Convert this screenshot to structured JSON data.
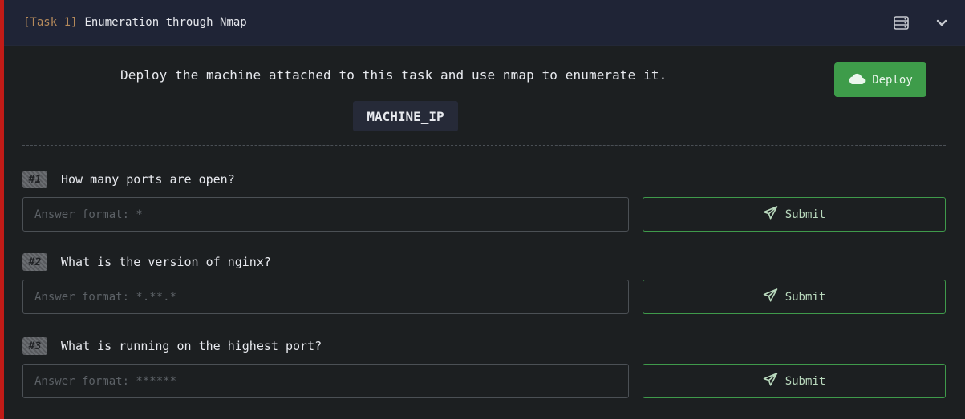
{
  "task": {
    "tag": "[Task 1]",
    "title": "Enumeration through Nmap",
    "icons": [
      "server-icon",
      "chevron-down-icon"
    ]
  },
  "intro": {
    "text": "Deploy the machine attached to this task and use nmap to enumerate it.",
    "machine_ip": "MACHINE_IP"
  },
  "deploy": {
    "label": "Deploy",
    "icon": "cloud-icon",
    "color": "#3e9c4a"
  },
  "questions": [
    {
      "number": "#1",
      "text": "How many ports are open?",
      "placeholder": "Answer format: *",
      "value": "",
      "submit_label": "Submit"
    },
    {
      "number": "#2",
      "text": "What is the version of nginx?",
      "placeholder": "Answer format: *.**.*",
      "value": "",
      "submit_label": "Submit"
    },
    {
      "number": "#3",
      "text": "What is running on the highest port?",
      "placeholder": "Answer format: ******",
      "value": "",
      "submit_label": "Submit"
    }
  ],
  "colors": {
    "accent": "#c11b17",
    "header_bg": "#1f2436",
    "success": "#3f9a4b"
  }
}
